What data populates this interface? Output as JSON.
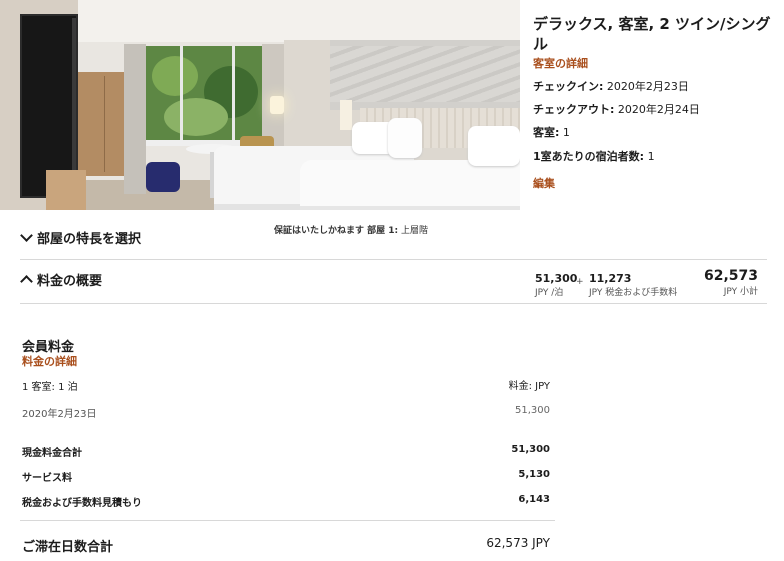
{
  "room": {
    "title": "デラックス, 客室, 2 ツイン/シングル",
    "details_link": "客室の詳細",
    "checkin_label": "チェックイン:",
    "checkin_value": "2020年2月23日",
    "checkout_label": "チェックアウト:",
    "checkout_value": "2020年2月24日",
    "rooms_label": "客室:",
    "rooms_value": "1",
    "guests_label": "1室あたりの宿泊者数:",
    "guests_value": "1",
    "edit_link": "編集"
  },
  "features": {
    "toggle_label": "部屋の特長を選択",
    "guarantee_bold": "保証はいたしかねます 部屋 1:",
    "guarantee_value": "上層階"
  },
  "summary": {
    "toggle_label": "料金の概要",
    "nightly_value": "51,300",
    "nightly_unit": "JPY /泊",
    "plus": "+",
    "tax_value": "11,273",
    "tax_unit": "JPY 税金および手数料",
    "total_value": "62,573",
    "total_unit": "JPY 小計"
  },
  "member_rate": {
    "title": "会員料金",
    "details_link": "料金の詳細",
    "room_nights": "1 客室: 1 泊",
    "rate_header": "料金: JPY",
    "date": "2020年2月23日",
    "date_value": "51,300",
    "cash_total_label": "現金料金合計",
    "cash_total_value": "51,300",
    "service_label": "サービス料",
    "service_value": "5,130",
    "tax_label": "税金および手数料見積もり",
    "tax_value": "6,143",
    "grand_label": "ご滞在日数合計",
    "grand_value": "62,573 JPY"
  },
  "colors": {
    "accent": "#a94f1d",
    "text": "#1c1c1c",
    "divider": "#d8d8d8"
  }
}
